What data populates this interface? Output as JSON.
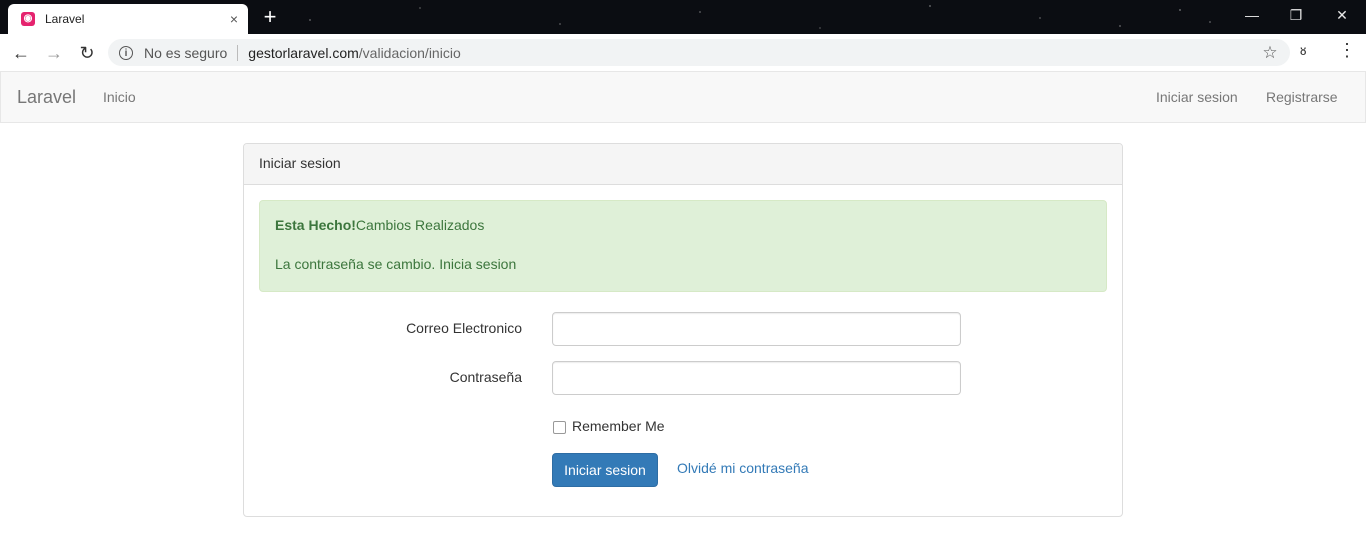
{
  "browser": {
    "tab_title": "Laravel",
    "tab_close": "×",
    "new_tab": "+",
    "security_label": "No es seguro",
    "url_host": "gestorlaravel.com",
    "url_path": "/validacion/inicio",
    "icons": {
      "favicon": "laravel-logo",
      "back": "arrow-left",
      "forward": "arrow-right",
      "reload": "reload",
      "info": "info-circle",
      "star": "star-outline",
      "incognito": "incognito",
      "menu": "vertical-dots",
      "minimize": "minimize",
      "restore": "restore",
      "close": "close"
    }
  },
  "navbar": {
    "brand": "Laravel",
    "links_left": [
      {
        "label": "Inicio"
      }
    ],
    "links_right": [
      {
        "label": "Iniciar sesion"
      },
      {
        "label": "Registrarse"
      }
    ]
  },
  "panel": {
    "heading": "Iniciar sesion",
    "alert": {
      "title": "Esta Hecho!",
      "message": "Cambios Realizados",
      "detail": "La contraseña se cambio. Inicia sesion",
      "color": "#3c763d",
      "background": "#dff0d8"
    },
    "form": {
      "email_label": "Correo Electronico",
      "email_value": "",
      "password_label": "Contraseña",
      "password_value": "",
      "remember_label": "Remember Me",
      "remember_checked": false,
      "submit_label": "Iniciar sesion",
      "forgot_label": "Olvidé mi contraseña"
    }
  },
  "colors": {
    "primary": "#337ab7",
    "navbar_bg": "#f8f8f8"
  }
}
